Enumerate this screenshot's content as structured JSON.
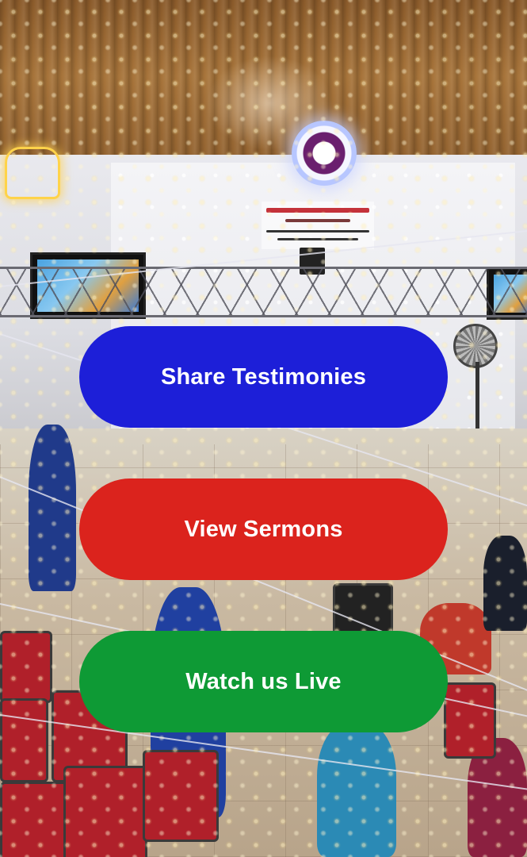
{
  "actions": {
    "share_testimonies": {
      "label": "Share Testimonies",
      "color": "#1d1fd8"
    },
    "view_sermons": {
      "label": "View Sermons",
      "color": "#db231d"
    },
    "watch_live": {
      "label": "Watch us Live",
      "color": "#0e9a35"
    }
  },
  "background": {
    "description_icon": "church-interior-photo"
  }
}
